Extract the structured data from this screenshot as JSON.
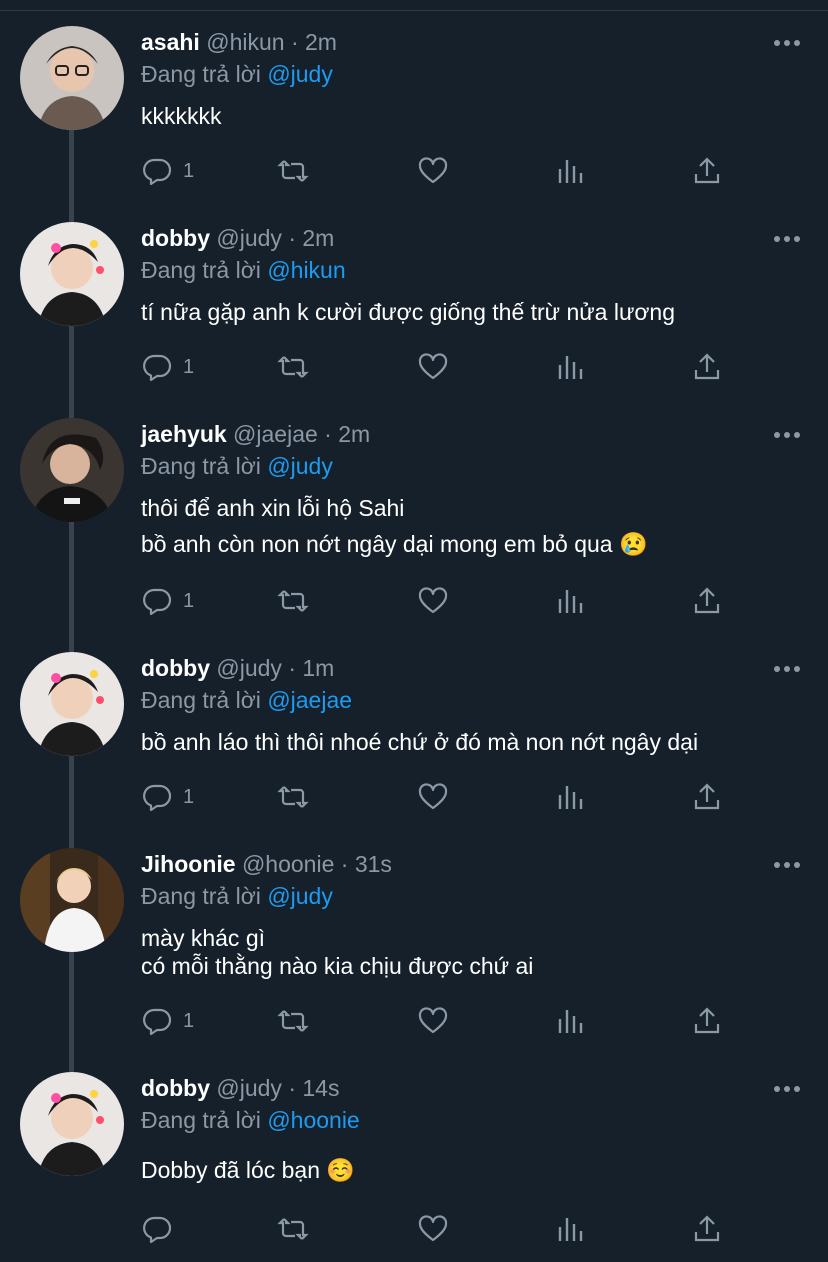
{
  "reply_prefix": "Đang trả lời",
  "tweets": [
    {
      "name": "asahi",
      "handle": "@hikun",
      "time": "· 2m",
      "reply_to": "@judy",
      "lines": [
        "kkkkkkk"
      ],
      "reply_count": "1",
      "avatar": "asahi-avatar"
    },
    {
      "name": "dobby",
      "handle": "@judy",
      "time": "· 2m",
      "reply_to": "@hikun",
      "lines": [
        "tí nữa gặp anh k cười được giống thế trừ nửa lương"
      ],
      "reply_count": "1",
      "avatar": "dobby-avatar"
    },
    {
      "name": "jaehyuk",
      "handle": "@jaejae",
      "time": "· 2m",
      "reply_to": "@judy",
      "lines": [
        "thôi để anh xin lỗi hộ Sahi",
        "bồ anh còn non nớt ngây dại mong em bỏ qua"
      ],
      "emoji": "😢",
      "reply_count": "1",
      "avatar": "jaehyuk-avatar"
    },
    {
      "name": "dobby",
      "handle": "@judy",
      "time": "· 1m",
      "reply_to": "@jaejae",
      "lines": [
        "bồ anh láo thì thôi nhoé chứ ở đó mà non nớt ngây dại"
      ],
      "reply_count": "1",
      "avatar": "dobby-avatar"
    },
    {
      "name": "Jihoonie",
      "handle": "@hoonie",
      "time": "· 31s",
      "reply_to": "@judy",
      "lines": [
        "mày khác gì",
        "có mỗi thằng nào kia chịu được chứ ai"
      ],
      "reply_count": "1",
      "avatar": "jihoonie-avatar"
    },
    {
      "name": "dobby",
      "handle": "@judy",
      "time": "· 14s",
      "reply_to": "@hoonie",
      "lines": [
        "Dobby đã lóc bạn"
      ],
      "emoji": "☺️",
      "reply_count": "",
      "avatar": "dobby-avatar"
    }
  ],
  "icons": {
    "reply": "reply-icon",
    "retweet": "retweet-icon",
    "like": "heart-icon",
    "analytics": "analytics-icon",
    "share": "share-icon",
    "more": "more-icon"
  },
  "colors": {
    "background": "#15202b",
    "muted": "#8b98a5",
    "link": "#1d9bf0",
    "thread_line": "#38444d"
  }
}
